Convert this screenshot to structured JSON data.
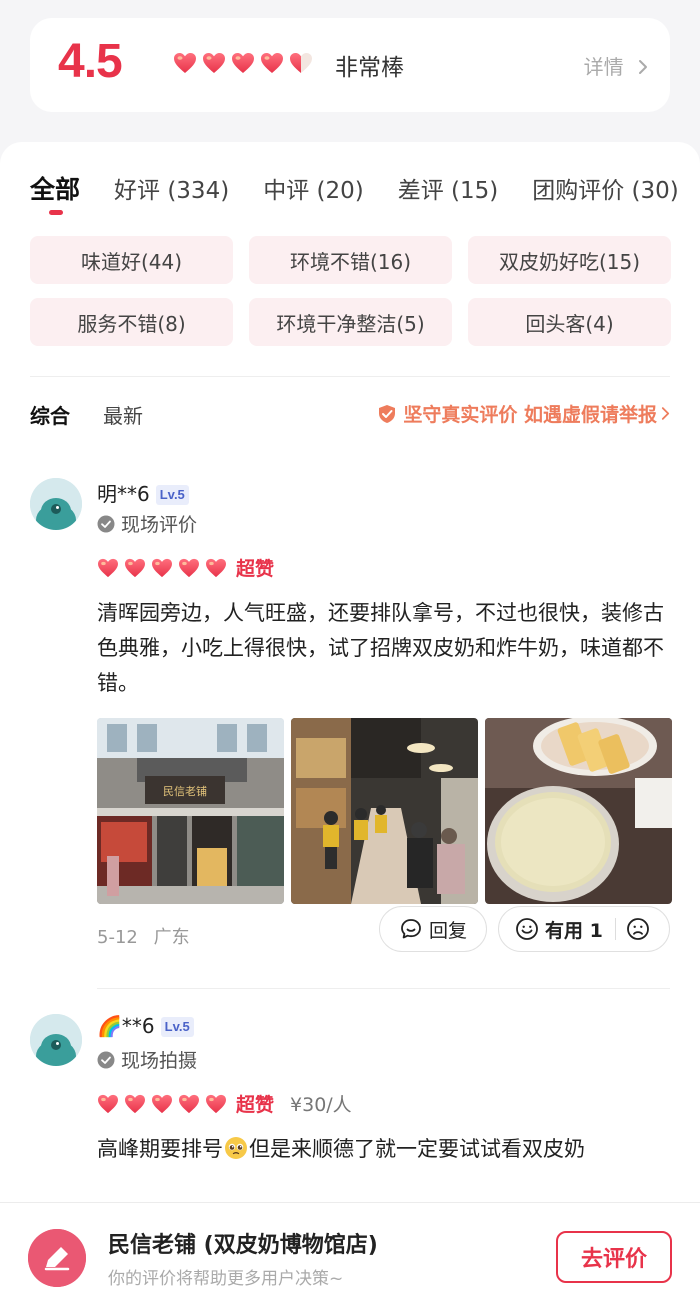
{
  "rating": {
    "score": "4.5",
    "label": "非常棒",
    "detail_label": "详情",
    "hearts_value": 4.5,
    "hearts_max": 5
  },
  "tabs": [
    {
      "label": "全部",
      "active": true
    },
    {
      "label": "好评 (334)",
      "active": false
    },
    {
      "label": "中评 (20)",
      "active": false
    },
    {
      "label": "差评 (15)",
      "active": false
    },
    {
      "label": "团购评价 (30)",
      "active": false
    }
  ],
  "tags": [
    "味道好(44)",
    "环境不错(16)",
    "双皮奶好吃(15)",
    "服务不错(8)",
    "环境干净整洁(5)",
    "回头客(4)"
  ],
  "sort": {
    "options": [
      "综合",
      "最新"
    ],
    "notice": "坚守真实评价 如遇虚假请举报"
  },
  "reviews": [
    {
      "username": "明**6",
      "level": "Lv.5",
      "verified_label": "现场评价",
      "stars": 5,
      "star_label": "超赞",
      "text": "清晖园旁边，人气旺盛，还要排队拿号，不过也很快，装修古色典雅，小吃上得很快，试了招牌双皮奶和炸牛奶，味道都不错。",
      "photo_sign_text": "民信老铺",
      "date": "5-12",
      "location": "广东",
      "reply_label": "回复",
      "useful_label": "有用 1"
    },
    {
      "username": "🌈**6",
      "level": "Lv.5",
      "verified_label": "现场拍摄",
      "stars": 5,
      "star_label": "超赞",
      "price": "¥30/人",
      "text_part1": "高峰期要排号",
      "text_part2": "但是来顺德了就一定要试试看双皮奶"
    }
  ],
  "bottom_bar": {
    "shop_name": "民信老铺 (双皮奶博物馆店)",
    "subtitle": "你的评价将帮助更多用户决策~",
    "button_label": "去评价"
  },
  "colors": {
    "accent": "#e8334a",
    "tag_bg": "#fceff1",
    "notice": "#ee7c5c"
  }
}
